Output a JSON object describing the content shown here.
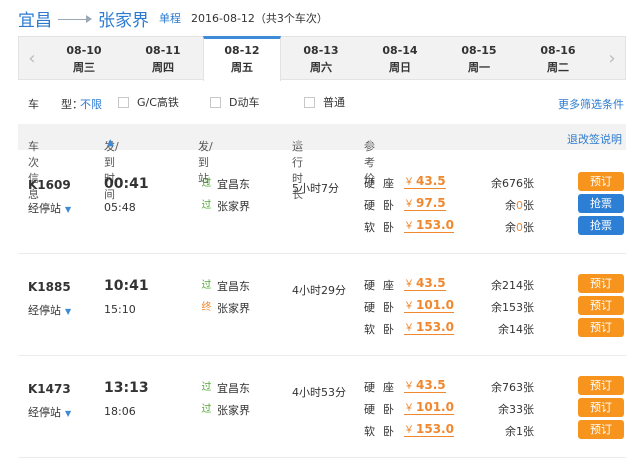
{
  "route": {
    "from": "宜昌",
    "to": "张家界",
    "trip_type": "单程",
    "date_info": "2016-08-12（共3个车次）"
  },
  "date_bar": {
    "prev_icon": "chevron-left-icon",
    "next_icon": "chevron-right-icon",
    "days": [
      {
        "date": "08-10",
        "weekday": "周三"
      },
      {
        "date": "08-11",
        "weekday": "周四"
      },
      {
        "date": "08-12",
        "weekday": "周五",
        "active": true
      },
      {
        "date": "08-13",
        "weekday": "周六"
      },
      {
        "date": "08-14",
        "weekday": "周日"
      },
      {
        "date": "08-15",
        "weekday": "周一"
      },
      {
        "date": "08-16",
        "weekday": "周二"
      }
    ]
  },
  "filter": {
    "label": "车　　型：",
    "value": "不限",
    "options": [
      "G/C高铁",
      "D动车",
      "普通"
    ],
    "more": "更多筛选条件"
  },
  "table_header": {
    "train_info": "车次信息",
    "time": "发/到时间",
    "station": "发/到站",
    "duration": "运行时长",
    "price": "参考价",
    "refund": "退改签说明"
  },
  "trains": [
    {
      "number": "K1609",
      "stops_label": "经停站",
      "depart": "00:41",
      "arrive": "05:48",
      "from_tag": "过",
      "from_station": "宜昌东",
      "to_tag": "过",
      "to_station": "张家界",
      "duration": "5小时7分",
      "seats": [
        {
          "name": "硬座",
          "price": "43.5",
          "left": "676",
          "action": "预订"
        },
        {
          "name": "硬卧",
          "price": "97.5",
          "left": "0",
          "action": "抢票"
        },
        {
          "name": "软卧",
          "price": "153.0",
          "left": "0",
          "action": "抢票"
        }
      ]
    },
    {
      "number": "K1885",
      "stops_label": "经停站",
      "depart": "10:41",
      "arrive": "15:10",
      "from_tag": "过",
      "from_station": "宜昌东",
      "to_tag": "终",
      "to_station": "张家界",
      "duration": "4小时29分",
      "seats": [
        {
          "name": "硬座",
          "price": "43.5",
          "left": "214",
          "action": "预订"
        },
        {
          "name": "硬卧",
          "price": "101.0",
          "left": "153",
          "action": "预订"
        },
        {
          "name": "软卧",
          "price": "153.0",
          "left": "14",
          "action": "预订"
        }
      ]
    },
    {
      "number": "K1473",
      "stops_label": "经停站",
      "depart": "13:13",
      "arrive": "18:06",
      "from_tag": "过",
      "from_station": "宜昌东",
      "to_tag": "过",
      "to_station": "张家界",
      "duration": "4小时53分",
      "seats": [
        {
          "name": "硬座",
          "price": "43.5",
          "left": "763",
          "action": "预订"
        },
        {
          "name": "硬卧",
          "price": "101.0",
          "left": "33",
          "action": "预订"
        },
        {
          "name": "软卧",
          "price": "153.0",
          "left": "1",
          "action": "预订"
        }
      ]
    }
  ],
  "labels": {
    "yen": "￥",
    "left_prefix": "余",
    "left_suffix": "张"
  }
}
